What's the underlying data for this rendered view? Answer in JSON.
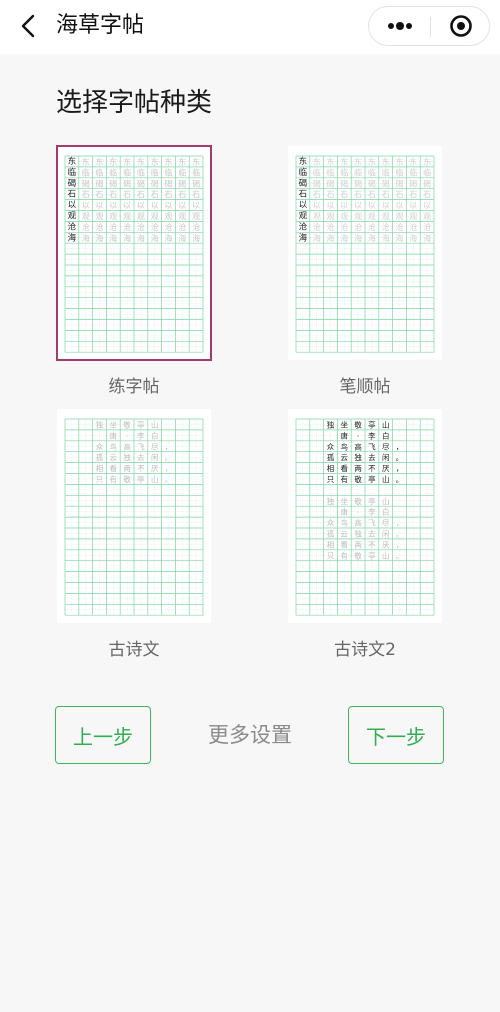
{
  "navbar": {
    "title": "海草字帖"
  },
  "section_title": "选择字帖种类",
  "templates": [
    {
      "label": "练字帖",
      "selected": true,
      "grid_color": "#7fd4a6",
      "leading_chars": [
        "东",
        "临",
        "碣",
        "石",
        "以",
        "观",
        "沧",
        "海"
      ],
      "trace_chars": [
        "东",
        "临",
        "碣",
        "石",
        "以",
        "观",
        "沧",
        "海"
      ]
    },
    {
      "label": "笔顺帖",
      "selected": false,
      "grid_color": "#7fd4a6",
      "leading_chars": [
        "东",
        "临",
        "碣",
        "石",
        "以",
        "观",
        "沧",
        "海"
      ],
      "trace_chars": [
        "东",
        "临",
        "碣",
        "石",
        "以",
        "观",
        "沧",
        "海"
      ]
    },
    {
      "label": "古诗文",
      "selected": false,
      "grid_color": "#7fd4a6",
      "poem_lines": [
        "独坐敬亭山",
        "唐·李白",
        "众鸟高飞尽，",
        "孤云独去闲。",
        "相看两不厌，",
        "只有敬亭山。"
      ]
    },
    {
      "label": "古诗文2",
      "selected": false,
      "grid_color": "#7fd4a6",
      "poem_lines": [
        "独坐敬亭山",
        "唐·李白",
        "众鸟高飞尽，",
        "孤云独去闲。",
        "相看两不厌，",
        "只有敬亭山。"
      ]
    }
  ],
  "footer": {
    "prev_label": "上一步",
    "settings_label": "更多设置",
    "next_label": "下一步"
  },
  "colors": {
    "accent": "#3fb65e",
    "selected_border": "#a23c6b"
  },
  "icons": {
    "back": "chevron-left-icon",
    "more": "more-dots-icon",
    "close": "close-circle-icon"
  }
}
